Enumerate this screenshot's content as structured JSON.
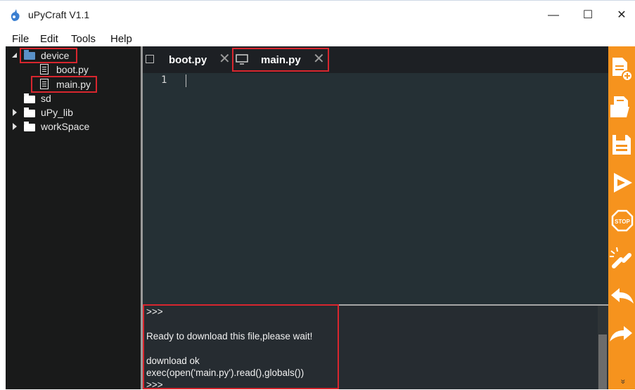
{
  "window": {
    "title": "uPyCraft V1.1",
    "minimize": "—",
    "maximize": "☐",
    "close": "✕"
  },
  "menu": [
    "File",
    "Edit",
    "Tools",
    "Help"
  ],
  "tree": {
    "device": "device",
    "device_files": [
      "boot.py",
      "main.py"
    ],
    "sd": "sd",
    "upy_lib": "uPy_lib",
    "workspace": "workSpace"
  },
  "tabs": [
    {
      "label": "boot.py",
      "close": "✕"
    },
    {
      "label": "main.py",
      "close": "✕"
    }
  ],
  "editor": {
    "line_numbers": [
      "1"
    ]
  },
  "console": {
    "lines": [
      ">>>",
      "Ready to download this file,please wait!",
      "download ok",
      "exec(open('main.py').read(),globals())",
      ">>>"
    ]
  },
  "toolbar": {
    "buttons": [
      "new-file-icon",
      "open-file-icon",
      "save-icon",
      "run-icon",
      "stop-icon",
      "connect-icon",
      "undo-icon",
      "redo-icon"
    ],
    "more": "»"
  },
  "colors": {
    "highlight": "#d8262e",
    "toolbar": "#f6931e",
    "editor_bg": "#253035",
    "tree_bg": "#191a1a"
  }
}
